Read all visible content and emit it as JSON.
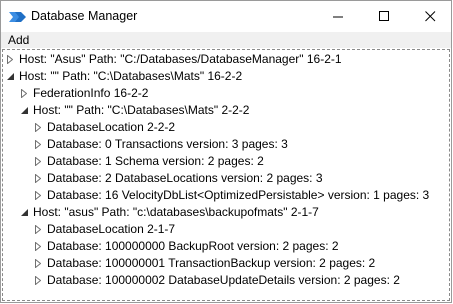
{
  "window": {
    "title": "Database Manager",
    "minimize_icon": "minimize-icon",
    "maximize_icon": "maximize-icon",
    "close_icon": "close-icon",
    "app_icon": "app-logo-icon",
    "accent_color": "#3c8ee3"
  },
  "menu": {
    "add_label": "Add"
  },
  "tree": {
    "rows": [
      {
        "label": "Host: \"Asus\" Path: \"C:/Databases/DatabaseManager\" 16-2-1",
        "expanded": false
      },
      {
        "label": "Host: \"\" Path: \"C:\\Databases\\Mats\" 16-2-2",
        "expanded": true
      },
      {
        "label": "FederationInfo 16-2-2",
        "expanded": false
      },
      {
        "label": "Host: \"\" Path: \"C:\\Databases\\Mats\" 2-2-2",
        "expanded": true
      },
      {
        "label": "DatabaseLocation 2-2-2",
        "expanded": false
      },
      {
        "label": "Database: 0 Transactions version: 3 pages: 3",
        "expanded": false
      },
      {
        "label": "Database: 1 Schema version: 2 pages: 2",
        "expanded": false
      },
      {
        "label": "Database: 2 DatabaseLocations version: 2 pages: 3",
        "expanded": false
      },
      {
        "label": "Database: 16 VelocityDbList<OptimizedPersistable> version: 1 pages: 3",
        "expanded": false
      },
      {
        "label": "Host: \"asus\" Path: \"c:\\databases\\backupofmats\" 2-1-7",
        "expanded": true
      },
      {
        "label": "DatabaseLocation 2-1-7",
        "expanded": false
      },
      {
        "label": "Database: 100000000 BackupRoot version: 2 pages: 2",
        "expanded": false
      },
      {
        "label": "Database: 100000001 TransactionBackup version: 2 pages: 2",
        "expanded": false
      },
      {
        "label": "Database: 100000002 DatabaseUpdateDetails version: 2 pages: 2",
        "expanded": false
      }
    ]
  }
}
